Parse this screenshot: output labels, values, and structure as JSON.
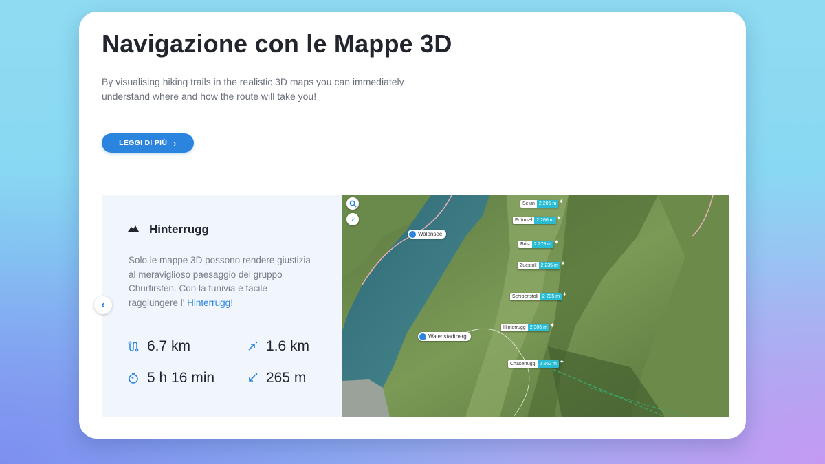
{
  "card": {
    "title": "Navigazione con le Mappe 3D",
    "description": "By visualising hiking trails in the realistic 3D maps you can immediately understand where and how the route will take you!",
    "more_button": "LEGGI DI PIÙ"
  },
  "tour": {
    "icon": "mountain-icon",
    "name": "Hinterrugg",
    "text_before": "Solo le mappe 3D possono rendere giustizia al meraviglioso paesaggio del gruppo Churfirsten. Con la funivia è facile raggiungere l'",
    "link": "Hinterrugg",
    "text_after": "!",
    "stats": {
      "distance": "6.7 km",
      "ascent": "1.6 km",
      "duration": "5 h 16 min",
      "descent": "265 m"
    }
  },
  "map": {
    "places": [
      "Walensee",
      "Walenstadtberg"
    ],
    "peaks": [
      {
        "name": "Selun",
        "elevation": "2 205 m"
      },
      {
        "name": "Frümsel",
        "elevation": "2 266 m"
      },
      {
        "name": "Brisi",
        "elevation": "2 279 m"
      },
      {
        "name": "Zuestoll",
        "elevation": "2 235 m"
      },
      {
        "name": "Schibenstoll",
        "elevation": "2 235 m"
      },
      {
        "name": "Hinterrugg",
        "elevation": "2 306 m"
      },
      {
        "name": "Chäserrugg",
        "elevation": "2 262 m"
      }
    ]
  },
  "colors": {
    "accent": "#2b84dd",
    "elevation_badge": "#2bbcd4",
    "panel_bg": "#f0f6fc",
    "lake": "#3f7d86"
  }
}
